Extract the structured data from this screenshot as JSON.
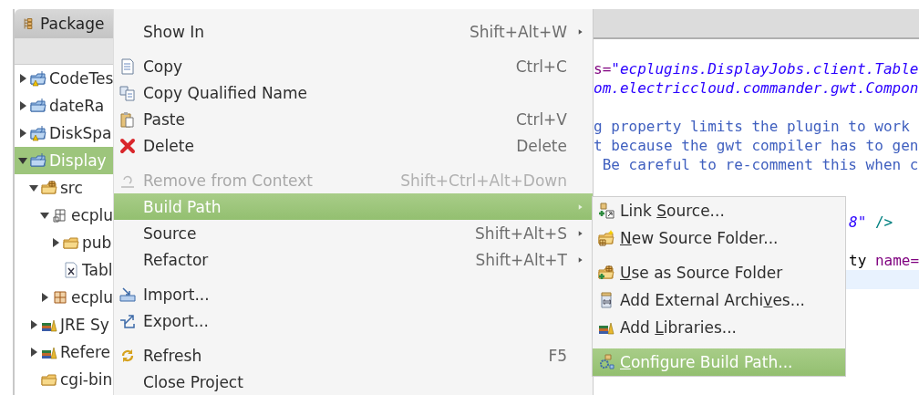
{
  "package_explorer": {
    "tab": {
      "label": "Package"
    },
    "tree": [
      {
        "label": "CodeTes",
        "kind": "warnproject",
        "expanded": false,
        "selected": false
      },
      {
        "label": "dateRa",
        "kind": "project",
        "expanded": false,
        "selected": false
      },
      {
        "label": "DiskSpa",
        "kind": "warnproject",
        "expanded": false,
        "selected": false
      },
      {
        "label": "Display",
        "kind": "project",
        "expanded": true,
        "selected": true,
        "children": [
          {
            "label": "src",
            "kind": "srcfolder",
            "expanded": true,
            "selected": false,
            "children": [
              {
                "label": "ecplu",
                "kind": "package",
                "expanded": true,
                "selected": false,
                "children": [
                  {
                    "label": "pub",
                    "kind": "folder",
                    "expanded": false,
                    "selected": false
                  },
                  {
                    "label": "Tabl",
                    "kind": "file",
                    "selected": false
                  }
                ]
              },
              {
                "label": "ecplu",
                "kind": "packagegrid",
                "expanded": false,
                "selected": false
              }
            ]
          },
          {
            "label": "JRE Sy",
            "kind": "library",
            "expanded": false,
            "selected": false
          },
          {
            "label": "Refere",
            "kind": "library",
            "expanded": false,
            "selected": false
          },
          {
            "label": "cgi-bin",
            "kind": "folder",
            "selected": false
          }
        ]
      }
    ]
  },
  "context_menu": {
    "items": [
      {
        "kind": "plain",
        "label": "Show In",
        "shortcut": "Shift+Alt+W",
        "submenu": true,
        "disabled": false,
        "selected": false
      },
      {
        "kind": "separator"
      },
      {
        "kind": "copy",
        "label": "Copy",
        "shortcut": "Ctrl+C",
        "submenu": false,
        "disabled": false,
        "selected": false
      },
      {
        "kind": "copyname",
        "label": "Copy Qualified Name",
        "submenu": false,
        "disabled": false,
        "selected": false
      },
      {
        "kind": "paste",
        "label": "Paste",
        "shortcut": "Ctrl+V",
        "submenu": false,
        "disabled": false,
        "selected": false
      },
      {
        "kind": "delete",
        "label": "Delete",
        "shortcut": "Delete",
        "submenu": false,
        "disabled": false,
        "selected": false
      },
      {
        "kind": "separator"
      },
      {
        "kind": "remove",
        "label": "Remove from Context",
        "shortcut": "Shift+Ctrl+Alt+Down",
        "submenu": false,
        "disabled": true,
        "selected": false
      },
      {
        "kind": "plain",
        "label": "Build Path",
        "submenu": true,
        "disabled": false,
        "selected": true
      },
      {
        "kind": "plain",
        "label": "Source",
        "shortcut": "Shift+Alt+S",
        "submenu": true,
        "disabled": false,
        "selected": false
      },
      {
        "kind": "plain",
        "label": "Refactor",
        "shortcut": "Shift+Alt+T",
        "submenu": true,
        "disabled": false,
        "selected": false
      },
      {
        "kind": "separator"
      },
      {
        "kind": "import",
        "label": "Import...",
        "submenu": false,
        "disabled": false,
        "selected": false
      },
      {
        "kind": "export",
        "label": "Export...",
        "submenu": false,
        "disabled": false,
        "selected": false
      },
      {
        "kind": "separator"
      },
      {
        "kind": "refresh",
        "label": "Refresh",
        "shortcut": "F5",
        "submenu": false,
        "disabled": false,
        "selected": false
      },
      {
        "kind": "plain",
        "label": "Close Project",
        "submenu": false,
        "disabled": false,
        "selected": false
      }
    ]
  },
  "build_path_submenu": {
    "items": [
      {
        "kind": "link",
        "before": "Link ",
        "key": "S",
        "after": "ource...",
        "selected": false
      },
      {
        "kind": "newfolder",
        "key": "N",
        "after": "ew Source Folder...",
        "selected": false
      },
      {
        "kind": "separator"
      },
      {
        "kind": "usefolder",
        "key": "U",
        "after": "se as Source Folder",
        "selected": false
      },
      {
        "kind": "archive",
        "before": "Add External Archi",
        "key": "v",
        "after": "es...",
        "selected": false
      },
      {
        "kind": "library",
        "before": "Add ",
        "key": "L",
        "after": "ibraries...",
        "selected": false
      },
      {
        "kind": "separator"
      },
      {
        "kind": "configure",
        "key": "C",
        "after": "onfigure Build Path...",
        "selected": true
      }
    ]
  },
  "editor": {
    "lines": [
      {
        "kind": "full",
        "current": false,
        "segments": [
          {
            "kind": "attribute",
            "text": "s="
          },
          {
            "kind": "string",
            "text": "\"ecplugins.DisplayJobs.client.Table"
          }
        ]
      },
      {
        "kind": "full",
        "current": false,
        "segments": [
          {
            "kind": "string",
            "text": "om.electriccloud.commander.gwt.Compon"
          }
        ]
      },
      {
        "kind": "blank",
        "current": false
      },
      {
        "kind": "full",
        "current": false,
        "segments": [
          {
            "kind": "comment",
            "text": "g property limits the plugin to work"
          }
        ]
      },
      {
        "kind": "full",
        "current": false,
        "segments": [
          {
            "kind": "comment",
            "text": "t because the gwt compiler has to gen"
          }
        ]
      },
      {
        "kind": "full",
        "current": false,
        "segments": [
          {
            "kind": "comment",
            "text": " Be careful to re-comment this when c"
          }
        ]
      },
      {
        "kind": "blank",
        "current": false
      },
      {
        "kind": "blank",
        "current": false
      },
      {
        "kind": "partial",
        "current": false,
        "segments": [
          {
            "kind": "string",
            "text": "8\""
          },
          {
            "kind": "tag",
            "text": " />"
          }
        ]
      },
      {
        "kind": "blank",
        "current": false
      },
      {
        "kind": "partial",
        "current": false,
        "segments": [
          {
            "kind": "plain",
            "text": "ty"
          },
          {
            "kind": "attribute",
            "text": " name="
          }
        ]
      },
      {
        "kind": "blank",
        "current": true
      }
    ]
  }
}
